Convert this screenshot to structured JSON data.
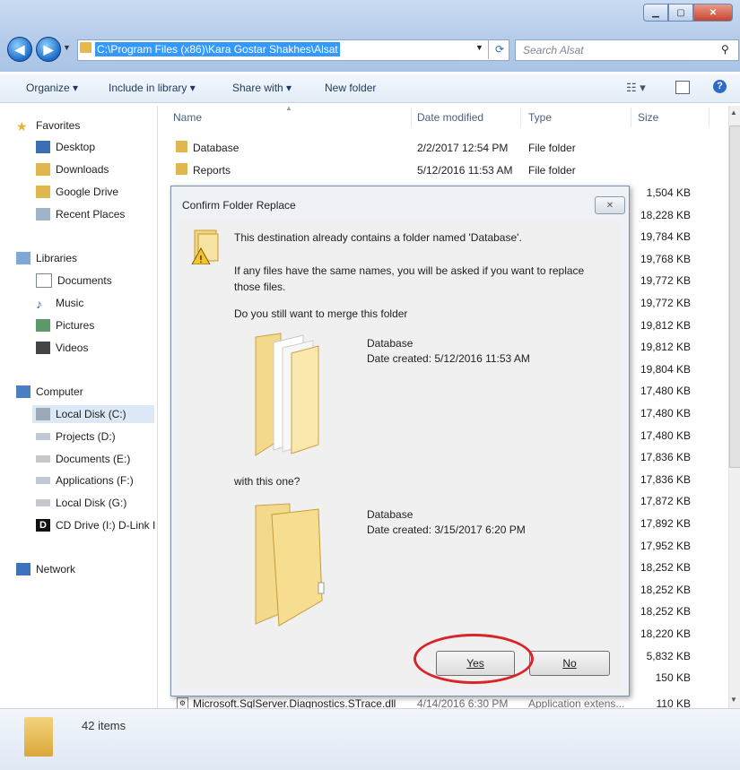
{
  "address": {
    "path": "C:\\Program Files (x86)\\Kara Gostar Shakhes\\Alsat",
    "search_placeholder": "Search Alsat"
  },
  "toolbar": {
    "organize": "Organize ▾",
    "include_in_library": "Include in library ▾",
    "share_with": "Share with ▾",
    "new_folder": "New folder"
  },
  "sidebar": {
    "favorites": "Favorites",
    "desktop": "Desktop",
    "downloads": "Downloads",
    "google_drive": "Google Drive",
    "recent_places": "Recent Places",
    "libraries": "Libraries",
    "documents": "Documents",
    "music": "Music",
    "pictures": "Pictures",
    "videos": "Videos",
    "computer": "Computer",
    "local_c": "Local Disk (C:)",
    "projects_d": "Projects (D:)",
    "documents_e": "Documents (E:)",
    "applications_f": "Applications (F:)",
    "local_g": "Local Disk (G:)",
    "cd_drive": "CD Drive (I:) D-Link I",
    "network": "Network"
  },
  "columns": {
    "name": "Name",
    "date_modified": "Date modified",
    "type": "Type",
    "size": "Size"
  },
  "files": [
    {
      "name": "Database",
      "date": "2/2/2017 12:54 PM",
      "type": "File folder"
    },
    {
      "name": "Reports",
      "date": "5/12/2016 11:53 AM",
      "type": "File folder"
    }
  ],
  "last_file": {
    "name": "Microsoft.SqlServer.Diagnostics.STrace.dll",
    "date": "4/14/2016 6:30 PM",
    "type": "Application extens...",
    "size": "110 KB"
  },
  "sizes": [
    "1,504 KB",
    "18,228 KB",
    "19,784 KB",
    "19,768 KB",
    "19,772 KB",
    "19,772 KB",
    "19,812 KB",
    "19,812 KB",
    "19,804 KB",
    "17,480 KB",
    "17,480 KB",
    "17,480 KB",
    "17,836 KB",
    "17,836 KB",
    "17,872 KB",
    "17,892 KB",
    "17,952 KB",
    "18,252 KB",
    "18,252 KB",
    "18,252 KB",
    "18,220 KB",
    "5,832 KB",
    "150 KB"
  ],
  "status": {
    "items": "42 items"
  },
  "dialog": {
    "title": "Confirm Folder Replace",
    "message": "This destination already contains a folder named 'Database'.",
    "note": "If any files have the same names, you will be asked if you want to replace those files.",
    "question": "Do you still want to merge this folder",
    "source_name": "Database",
    "source_created": "Date created: 5/12/2016 11:53 AM",
    "with_this": "with this one?",
    "dest_name": "Database",
    "dest_created": "Date created: 3/15/2017 6:20 PM",
    "yes": "Yes",
    "no": "No"
  },
  "colors": {
    "highlight": "#3399ff",
    "annotation_circle": "#d9242a"
  }
}
